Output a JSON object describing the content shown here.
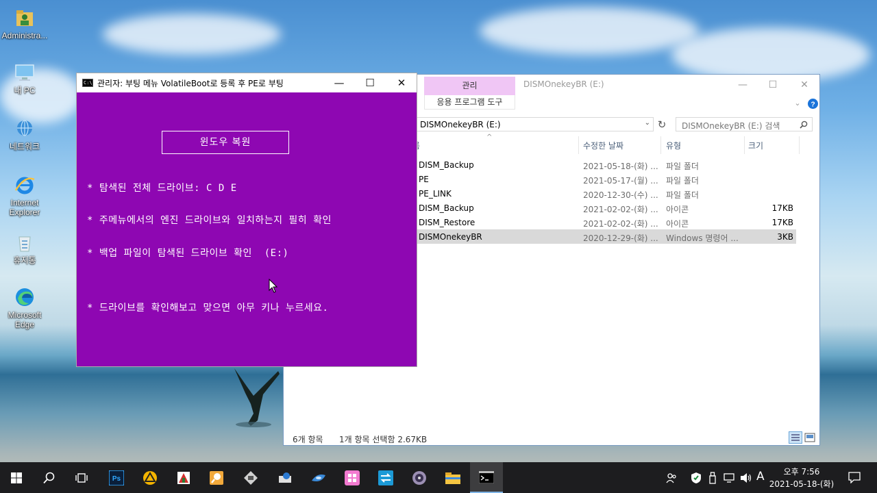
{
  "desktop": {
    "icons": [
      {
        "label": "Administra..."
      },
      {
        "label": "내 PC"
      },
      {
        "label": "네트워크"
      },
      {
        "label": "Internet Explorer"
      },
      {
        "label": "휴지통"
      },
      {
        "label": "Microsoft Edge"
      }
    ]
  },
  "explorer": {
    "ribbon_tab": "관리",
    "ribbon_subtab": "응용 프로그램 도구",
    "title": "DISMOnekeyBR (E:)",
    "address": "DISMOnekeyBR (E:)",
    "search_placeholder": "DISMOnekeyBR (E:) 검색",
    "columns": {
      "name": "름",
      "date": "수정한 날짜",
      "type": "유형",
      "size": "크기"
    },
    "rows": [
      {
        "name": "DISM_Backup",
        "date": "2021-05-18-(화) ...",
        "type": "파일 폴더",
        "size": ""
      },
      {
        "name": "PE",
        "date": "2021-05-17-(월) ...",
        "type": "파일 폴더",
        "size": ""
      },
      {
        "name": "PE_LINK",
        "date": "2020-12-30-(수) ...",
        "type": "파일 폴더",
        "size": ""
      },
      {
        "name": "DISM_Backup",
        "date": "2021-02-02-(화) ...",
        "type": "아이콘",
        "size": "17KB"
      },
      {
        "name": "DISM_Restore",
        "date": "2021-02-02-(화) ...",
        "type": "아이콘",
        "size": "17KB"
      },
      {
        "name": "DISMOnekeyBR",
        "date": "2020-12-29-(화) ...",
        "type": "Windows 명령어 ...",
        "size": "3KB"
      }
    ],
    "status_count": "6개 항목",
    "status_selected": "1개 항목 선택함 2.67KB",
    "colors": {
      "ribbon_accent": "#f0c6f5",
      "selected_row": "#d9d9d9"
    }
  },
  "console": {
    "title": "관리자:  부팅 메뉴 VolatileBoot로 등록 후 PE로 부팅",
    "box_label": "윈도우  복원",
    "lines": [
      "* 탐색된 전체 드라이브: C D E",
      "* 주메뉴에서의 엔진 드라이브와 일치하는지 필히 확인",
      "* 백업 파일이 탐색된 드라이브 확인  (E:)",
      "* 드라이브를 확인해보고 맞으면 아무 키나 누르세요."
    ],
    "colors": {
      "background": "#8e07b2",
      "text": "#ffffff"
    }
  },
  "taskbar": {
    "ime": "A",
    "time": "오후 7:56",
    "date": "2021-05-18-(화)",
    "apps": [
      "start-icon",
      "search-icon",
      "task-view-icon",
      "photoshop-icon",
      "drive-icon",
      "document-icon",
      "search-tool-icon",
      "usb-icon",
      "tool-icon",
      "disk-icon",
      "app-icon",
      "remote-icon",
      "dvd-icon",
      "folder-icon",
      "cmd-icon"
    ]
  }
}
